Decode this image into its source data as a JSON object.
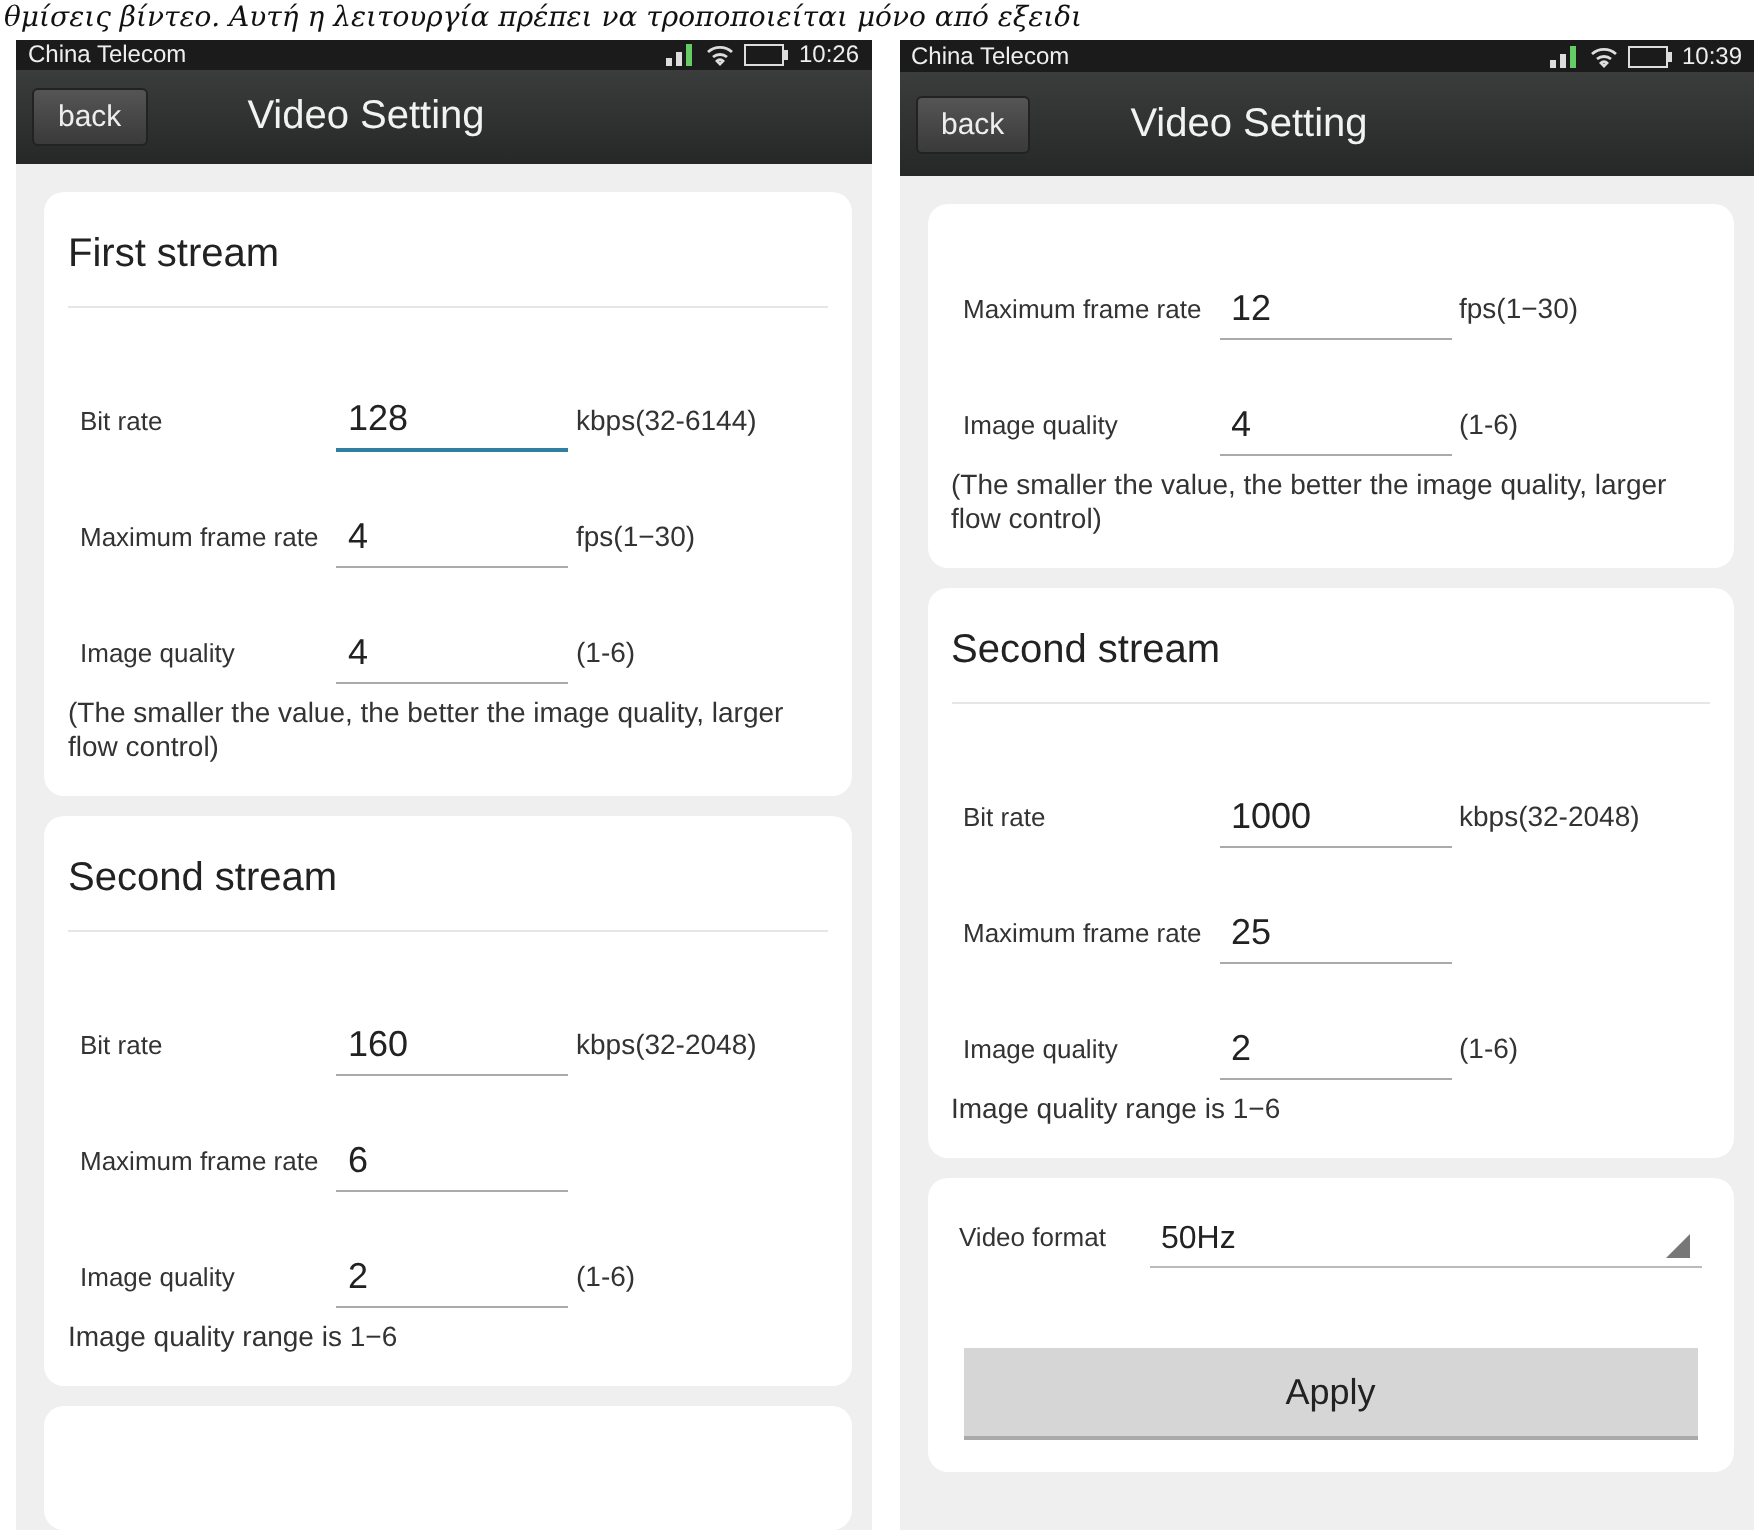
{
  "caption": "θμίσεις βίντεο. Αυτή η λειτουργία πρέπει να τροποποιείται μόνο από εξειδι",
  "screens": [
    {
      "status_bar": {
        "carrier": "China Telecom",
        "time": "10:26"
      },
      "header": {
        "back_label": "back",
        "title": "Video Setting"
      },
      "cards": [
        {
          "kind": "stream",
          "title": "First stream",
          "fields": [
            {
              "label": "Bit rate",
              "value": "128",
              "unit": "kbps(32-6144)",
              "focused": true
            },
            {
              "label": "Maximum frame rate",
              "value": "4",
              "unit": "fps(1−30)",
              "focused": false
            },
            {
              "label": "Image quality",
              "value": "4",
              "unit": "(1-6)",
              "focused": false
            }
          ],
          "note": "(The smaller the value, the better the image quality, larger flow control)"
        },
        {
          "kind": "stream",
          "title": "Second stream",
          "fields": [
            {
              "label": "Bit rate",
              "value": "160",
              "unit": "kbps(32-2048)",
              "focused": false
            },
            {
              "label": "Maximum frame rate",
              "value": "6",
              "focused": false
            },
            {
              "label": "Image quality",
              "value": "2",
              "unit": "(1-6)",
              "focused": false
            }
          ],
          "note": "Image quality range is 1−6"
        },
        {
          "kind": "peek"
        }
      ]
    },
    {
      "status_bar": {
        "carrier": "China Telecom",
        "time": "10:39"
      },
      "header": {
        "back_label": "back",
        "title": "Video Setting"
      },
      "cards": [
        {
          "kind": "stream",
          "fields": [
            {
              "label": "Maximum frame rate",
              "value": "12",
              "unit": "fps(1−30)",
              "focused": false
            },
            {
              "label": "Image quality",
              "value": "4",
              "unit": "(1-6)",
              "focused": false
            }
          ],
          "note": "(The smaller the value, the better the image quality, larger flow control)"
        },
        {
          "kind": "stream",
          "title": "Second stream",
          "fields": [
            {
              "label": "Bit rate",
              "value": "1000",
              "unit": "kbps(32-2048)",
              "focused": false
            },
            {
              "label": "Maximum frame rate",
              "value": "25",
              "focused": false
            },
            {
              "label": "Image quality",
              "value": "2",
              "unit": "(1-6)",
              "focused": false
            }
          ],
          "note": "Image quality range is 1−6"
        },
        {
          "kind": "format",
          "label": "Video format",
          "value": "50Hz",
          "button": "Apply"
        }
      ]
    }
  ]
}
